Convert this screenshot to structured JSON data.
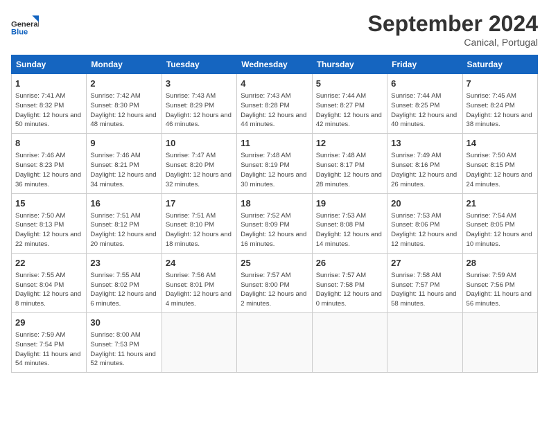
{
  "logo": {
    "general": "General",
    "blue": "Blue"
  },
  "title": "September 2024",
  "subtitle": "Canical, Portugal",
  "days_of_week": [
    "Sunday",
    "Monday",
    "Tuesday",
    "Wednesday",
    "Thursday",
    "Friday",
    "Saturday"
  ],
  "weeks": [
    [
      {
        "day": "1",
        "sunrise": "7:41 AM",
        "sunset": "8:32 PM",
        "daylight": "12 hours and 50 minutes."
      },
      {
        "day": "2",
        "sunrise": "7:42 AM",
        "sunset": "8:30 PM",
        "daylight": "12 hours and 48 minutes."
      },
      {
        "day": "3",
        "sunrise": "7:43 AM",
        "sunset": "8:29 PM",
        "daylight": "12 hours and 46 minutes."
      },
      {
        "day": "4",
        "sunrise": "7:43 AM",
        "sunset": "8:28 PM",
        "daylight": "12 hours and 44 minutes."
      },
      {
        "day": "5",
        "sunrise": "7:44 AM",
        "sunset": "8:27 PM",
        "daylight": "12 hours and 42 minutes."
      },
      {
        "day": "6",
        "sunrise": "7:44 AM",
        "sunset": "8:25 PM",
        "daylight": "12 hours and 40 minutes."
      },
      {
        "day": "7",
        "sunrise": "7:45 AM",
        "sunset": "8:24 PM",
        "daylight": "12 hours and 38 minutes."
      }
    ],
    [
      {
        "day": "8",
        "sunrise": "7:46 AM",
        "sunset": "8:23 PM",
        "daylight": "12 hours and 36 minutes."
      },
      {
        "day": "9",
        "sunrise": "7:46 AM",
        "sunset": "8:21 PM",
        "daylight": "12 hours and 34 minutes."
      },
      {
        "day": "10",
        "sunrise": "7:47 AM",
        "sunset": "8:20 PM",
        "daylight": "12 hours and 32 minutes."
      },
      {
        "day": "11",
        "sunrise": "7:48 AM",
        "sunset": "8:19 PM",
        "daylight": "12 hours and 30 minutes."
      },
      {
        "day": "12",
        "sunrise": "7:48 AM",
        "sunset": "8:17 PM",
        "daylight": "12 hours and 28 minutes."
      },
      {
        "day": "13",
        "sunrise": "7:49 AM",
        "sunset": "8:16 PM",
        "daylight": "12 hours and 26 minutes."
      },
      {
        "day": "14",
        "sunrise": "7:50 AM",
        "sunset": "8:15 PM",
        "daylight": "12 hours and 24 minutes."
      }
    ],
    [
      {
        "day": "15",
        "sunrise": "7:50 AM",
        "sunset": "8:13 PM",
        "daylight": "12 hours and 22 minutes."
      },
      {
        "day": "16",
        "sunrise": "7:51 AM",
        "sunset": "8:12 PM",
        "daylight": "12 hours and 20 minutes."
      },
      {
        "day": "17",
        "sunrise": "7:51 AM",
        "sunset": "8:10 PM",
        "daylight": "12 hours and 18 minutes."
      },
      {
        "day": "18",
        "sunrise": "7:52 AM",
        "sunset": "8:09 PM",
        "daylight": "12 hours and 16 minutes."
      },
      {
        "day": "19",
        "sunrise": "7:53 AM",
        "sunset": "8:08 PM",
        "daylight": "12 hours and 14 minutes."
      },
      {
        "day": "20",
        "sunrise": "7:53 AM",
        "sunset": "8:06 PM",
        "daylight": "12 hours and 12 minutes."
      },
      {
        "day": "21",
        "sunrise": "7:54 AM",
        "sunset": "8:05 PM",
        "daylight": "12 hours and 10 minutes."
      }
    ],
    [
      {
        "day": "22",
        "sunrise": "7:55 AM",
        "sunset": "8:04 PM",
        "daylight": "12 hours and 8 minutes."
      },
      {
        "day": "23",
        "sunrise": "7:55 AM",
        "sunset": "8:02 PM",
        "daylight": "12 hours and 6 minutes."
      },
      {
        "day": "24",
        "sunrise": "7:56 AM",
        "sunset": "8:01 PM",
        "daylight": "12 hours and 4 minutes."
      },
      {
        "day": "25",
        "sunrise": "7:57 AM",
        "sunset": "8:00 PM",
        "daylight": "12 hours and 2 minutes."
      },
      {
        "day": "26",
        "sunrise": "7:57 AM",
        "sunset": "7:58 PM",
        "daylight": "12 hours and 0 minutes."
      },
      {
        "day": "27",
        "sunrise": "7:58 AM",
        "sunset": "7:57 PM",
        "daylight": "11 hours and 58 minutes."
      },
      {
        "day": "28",
        "sunrise": "7:59 AM",
        "sunset": "7:56 PM",
        "daylight": "11 hours and 56 minutes."
      }
    ],
    [
      {
        "day": "29",
        "sunrise": "7:59 AM",
        "sunset": "7:54 PM",
        "daylight": "11 hours and 54 minutes."
      },
      {
        "day": "30",
        "sunrise": "8:00 AM",
        "sunset": "7:53 PM",
        "daylight": "11 hours and 52 minutes."
      },
      null,
      null,
      null,
      null,
      null
    ]
  ]
}
